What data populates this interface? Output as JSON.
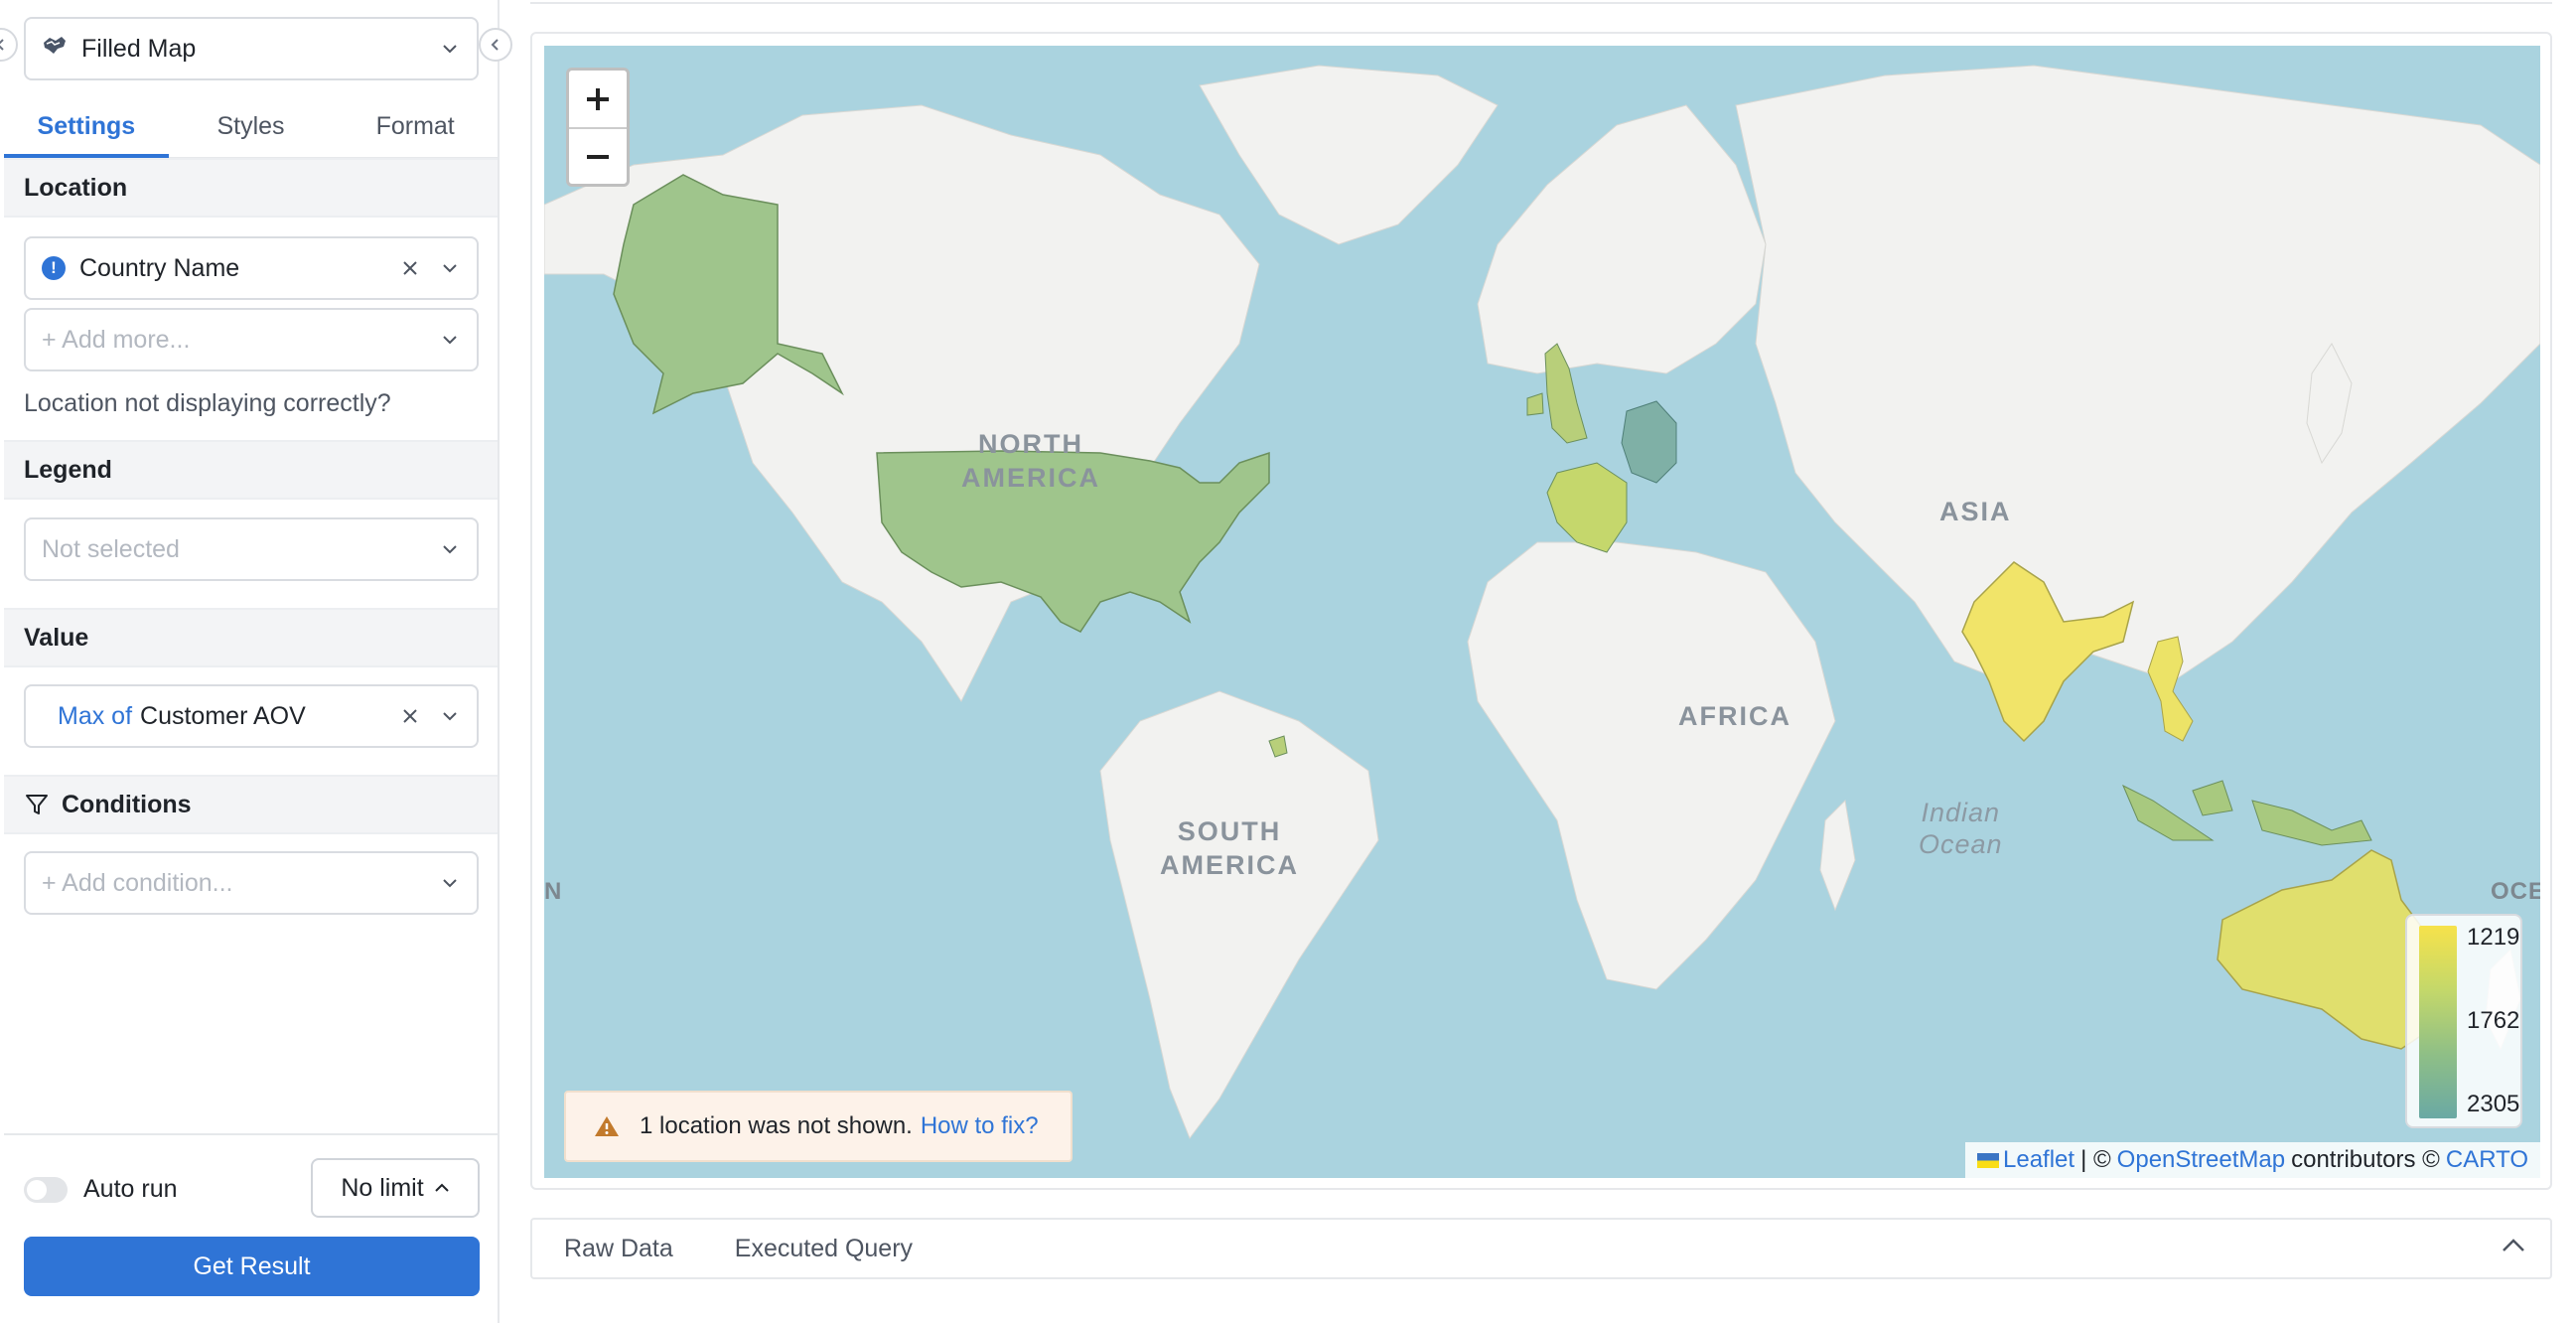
{
  "panel": {
    "viz_type": "Filled Map",
    "tabs": [
      {
        "label": "Settings",
        "active": true
      },
      {
        "label": "Styles",
        "active": false
      },
      {
        "label": "Format",
        "active": false
      }
    ],
    "location": {
      "title": "Location",
      "field": "Country Name",
      "add_placeholder": "+ Add more...",
      "help": "Location not displaying correctly?"
    },
    "legend": {
      "title": "Legend",
      "placeholder": "Not selected"
    },
    "value": {
      "title": "Value",
      "aggregation": "Max of",
      "field": "Customer AOV"
    },
    "conditions": {
      "title": "Conditions",
      "placeholder": "+ Add condition..."
    },
    "footer": {
      "auto_run": "Auto run",
      "auto_run_on": false,
      "limit": "No limit",
      "get_result": "Get Result"
    }
  },
  "map": {
    "labels": {
      "north_america": "NORTH\nAMERICA",
      "south_america": "SOUTH\nAMERICA",
      "africa": "AFRICA",
      "asia": "ASIA",
      "indian_ocean": "Indian\nOcean",
      "edge_left": "N",
      "edge_right": "OCE"
    },
    "notice": {
      "text": "1 location was not shown.",
      "link": "How to fix?"
    },
    "legend": {
      "values": [
        "1219",
        "1762",
        "2305"
      ],
      "colors": [
        "#f6e24b",
        "#8fbf86",
        "#6aa9a4"
      ]
    },
    "attribution": {
      "leaflet": "Leaflet",
      "sep": "| ©",
      "osm": "OpenStreetMap",
      "contrib": "contributors ©",
      "carto": "CARTO"
    },
    "colors": {
      "water": "#aad3df",
      "land": "#f2f2f0",
      "usa": "#9fc58c",
      "alaska": "#9fc58c",
      "uk": "#b8cf7a",
      "france": "#c5d76c",
      "germany": "#7fb0a6",
      "india": "#f1e469",
      "vietnam": "#ece367",
      "indonesia": "#a8c97f",
      "australia": "#e0df6d",
      "guyana": "#b8cf7a"
    }
  },
  "bottom_tabs": [
    "Raw Data",
    "Executed Query"
  ]
}
